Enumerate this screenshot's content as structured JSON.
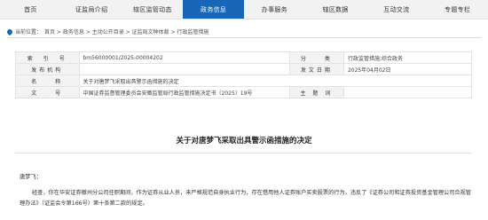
{
  "nav": {
    "items": [
      {
        "label": "首页",
        "active": false
      },
      {
        "label": "证监局介绍",
        "active": false
      },
      {
        "label": "辖区监管动态",
        "active": false
      },
      {
        "label": "政务信息",
        "active": true
      },
      {
        "label": "办事服务",
        "active": false
      },
      {
        "label": "辖区数据",
        "active": false
      },
      {
        "label": "互动交流",
        "active": false
      },
      {
        "label": "专题专栏",
        "active": false
      }
    ],
    "active_color": "#1766b8"
  },
  "breadcrumb": {
    "prefix": "当前位置：",
    "path": "首页 > 政务信息 > 主动公开目录 > 证监局文种体裁 > 行政监管措施"
  },
  "meta": {
    "index_label": "索　引　号",
    "index_value": "bm56000001/2025-00004202",
    "category_label": "分　　类",
    "category_value": "行政监管措施;综合政务",
    "publisher_label": "发布机构",
    "publisher_value": "",
    "date_label": "发文日期",
    "date_value": "2025年04月02日",
    "name_label": "名　　称",
    "name_value": "关于对唐梦飞采取出具警示函措施的决定",
    "docno_label": "文　　号",
    "docno_value": "中国证券监督管理委员会安徽监管局行政监管措施决定书〔2025〕19号",
    "subject_label": "主 题 词",
    "subject_value": ""
  },
  "article": {
    "title": "关于对唐梦飞采取出具警示函措施的决定",
    "salutation": "唐梦飞：",
    "paragraph": "经查，你在华安证券徽州分公司任职期间，作为证券从业人员，未严格规范自身执业行为，存在借用他人证券账户买卖股票的行为，违反了《证券公司和证券投资基金管理公司合规管理办法》（证监会令第166号）第十条第二款的规定。"
  }
}
